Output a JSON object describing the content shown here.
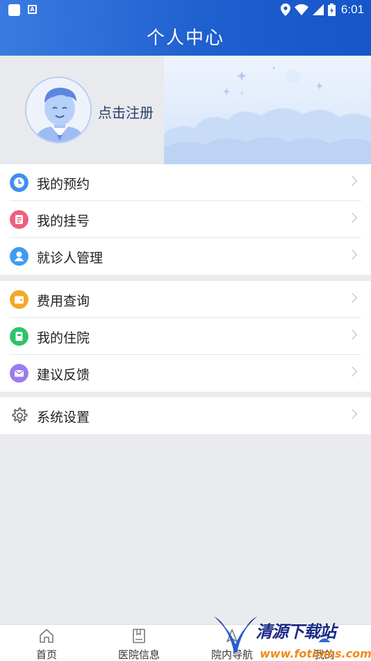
{
  "status_bar": {
    "time": "6:01"
  },
  "header": {
    "title": "个人中心"
  },
  "profile": {
    "register_label": "点击注册"
  },
  "menu_groups": [
    {
      "items": [
        {
          "label": "我的预约",
          "icon": "clock-icon",
          "color": "#3d8ff0"
        },
        {
          "label": "我的挂号",
          "icon": "register-ticket-icon",
          "color": "#ee5f7d"
        },
        {
          "label": "就诊人管理",
          "icon": "patient-person-icon",
          "color": "#3d9cf0"
        }
      ]
    },
    {
      "items": [
        {
          "label": "费用查询",
          "icon": "wallet-icon",
          "color": "#f5a623"
        },
        {
          "label": "我的住院",
          "icon": "hospital-bed-icon",
          "color": "#2ec36a"
        },
        {
          "label": "建议反馈",
          "icon": "mail-icon",
          "color": "#9b7bf0"
        }
      ]
    },
    {
      "items": [
        {
          "label": "系统设置",
          "icon": "gear-icon",
          "color": "#555555"
        }
      ]
    }
  ],
  "bottom_nav": [
    {
      "label": "首页",
      "icon": "home-icon"
    },
    {
      "label": "医院信息",
      "icon": "book-icon"
    },
    {
      "label": "院内导航",
      "icon": "navigation-icon"
    },
    {
      "label": "我的",
      "icon": "user-icon"
    }
  ],
  "watermark": {
    "title": "清源下载站",
    "url": "www.fotimes.com"
  }
}
